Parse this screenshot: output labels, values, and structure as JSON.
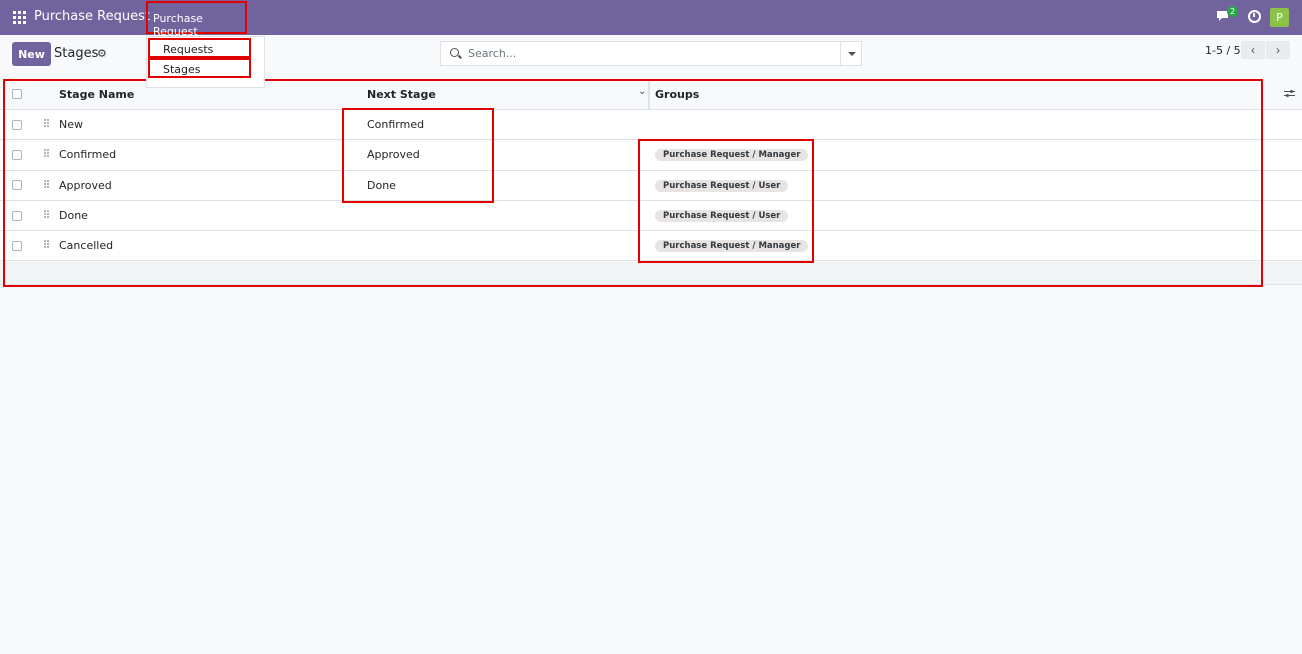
{
  "topbar": {
    "app_title": "Purchase Request",
    "menu_label": "Purchase Request",
    "chat_badge": "2",
    "avatar_initial": "P",
    "colors": {
      "bar": "#71639e",
      "avatar": "#8bc34a",
      "badge": "#28a745",
      "highlight": "#e00000"
    }
  },
  "menu": {
    "items": [
      {
        "label": "Requests"
      },
      {
        "label": "Stages"
      }
    ]
  },
  "control": {
    "new_label": "New",
    "breadcrumb": "Stages",
    "search_placeholder": "Search...",
    "pager": "1-5 / 5"
  },
  "list": {
    "headers": {
      "stage_name": "Stage Name",
      "next_stage": "Next Stage",
      "groups": "Groups"
    },
    "rows": [
      {
        "name": "New",
        "next": "Confirmed",
        "group": ""
      },
      {
        "name": "Confirmed",
        "next": "Approved",
        "group": "Purchase Request / Manager"
      },
      {
        "name": "Approved",
        "next": "Done",
        "group": "Purchase Request / User"
      },
      {
        "name": "Done",
        "next": "",
        "group": "Purchase Request / User"
      },
      {
        "name": "Cancelled",
        "next": "",
        "group": "Purchase Request / Manager"
      }
    ]
  }
}
